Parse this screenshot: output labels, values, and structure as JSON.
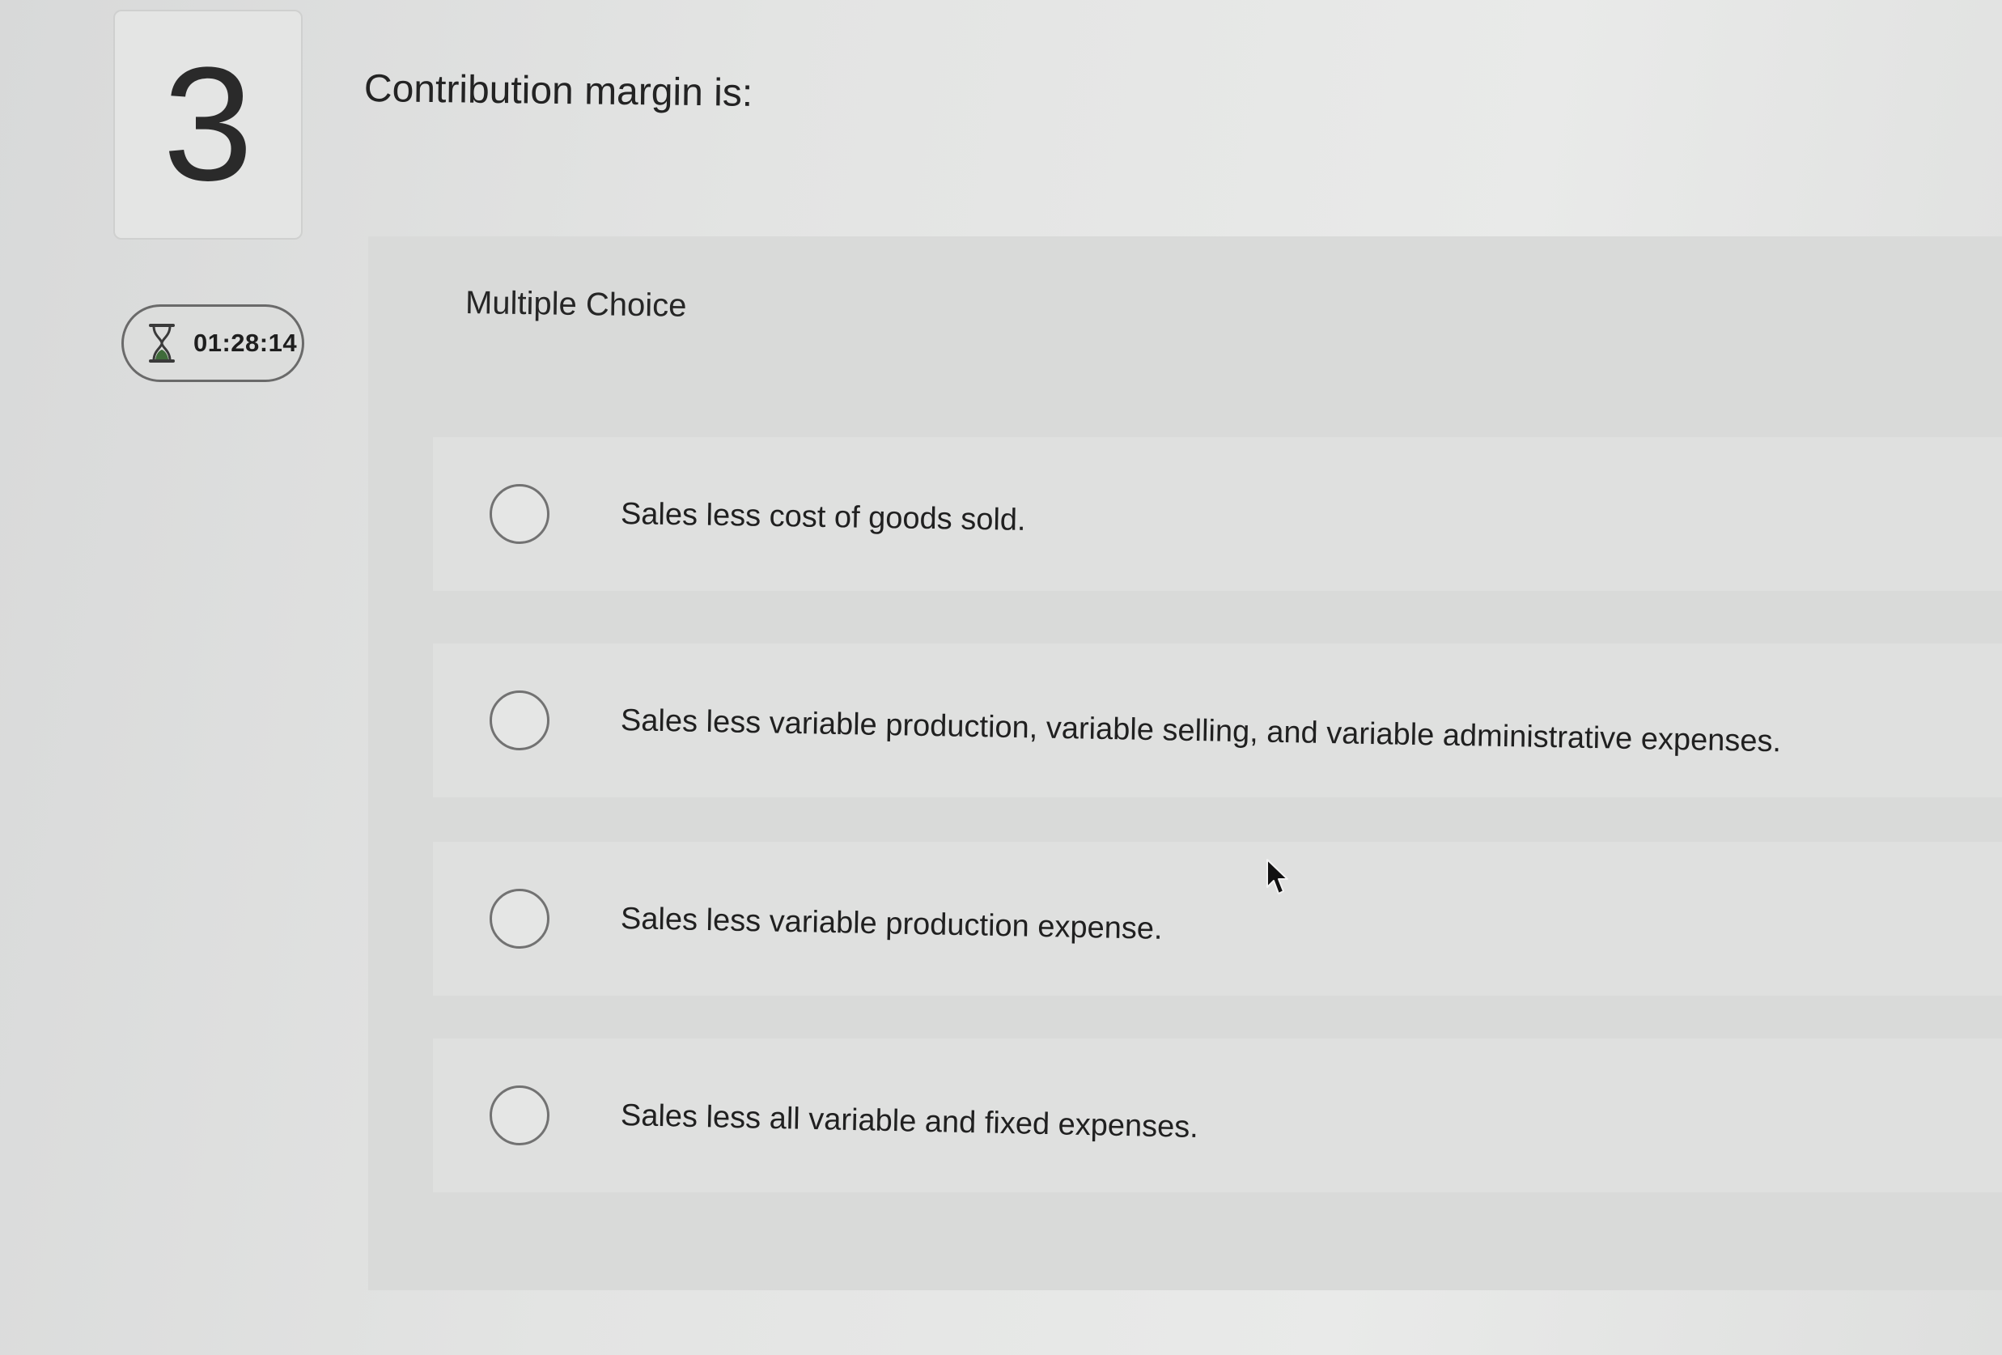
{
  "question": {
    "number": "3",
    "prompt": "Contribution margin is:",
    "type_label": "Multiple Choice"
  },
  "timer": {
    "time": "01:28:14",
    "icon": "hourglass-icon"
  },
  "choices": [
    {
      "label": "Sales less cost of goods sold."
    },
    {
      "label": "Sales less variable production, variable selling, and variable administrative expenses."
    },
    {
      "label": "Sales less variable production expense."
    },
    {
      "label": "Sales less all variable and fixed expenses."
    }
  ],
  "colors": {
    "background": "#e3e4e3",
    "panel": "#d9dad9",
    "choice_background": "#dfe0df",
    "radio_border": "#727272",
    "hourglass_sand": "#3f6b3a",
    "text": "#202020"
  }
}
